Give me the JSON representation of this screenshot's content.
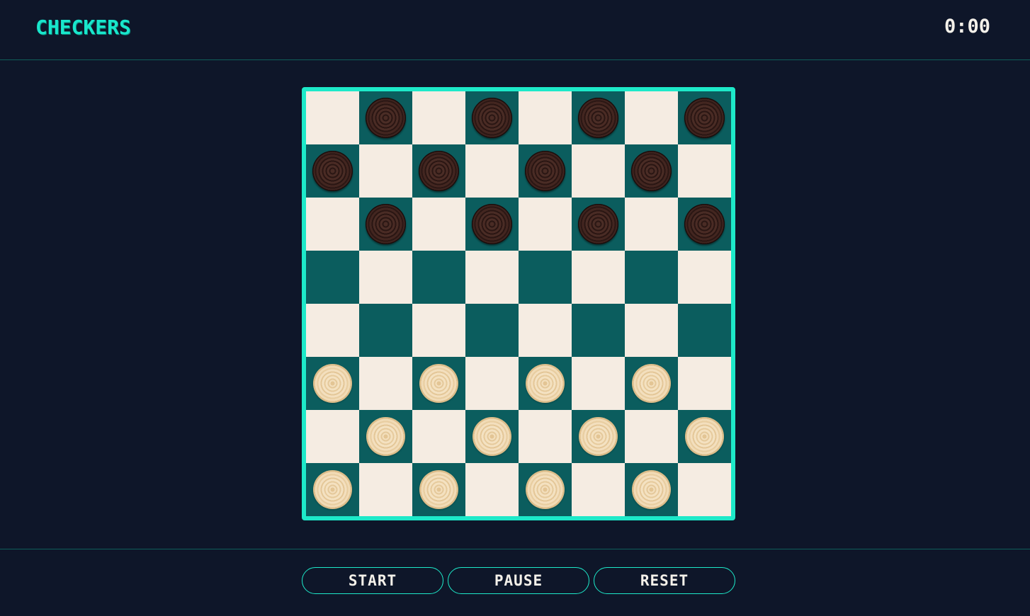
{
  "header": {
    "title": "CHECKERS",
    "timer": "0:00"
  },
  "board": {
    "size": 8,
    "colors": {
      "light_square": "#f5ece2",
      "dark_square": "#0b5d5e",
      "frame": "#1de9c9"
    },
    "rows": [
      [
        ".",
        "b",
        ".",
        "b",
        ".",
        "b",
        ".",
        "b"
      ],
      [
        "b",
        ".",
        "b",
        ".",
        "b",
        ".",
        "b",
        "."
      ],
      [
        ".",
        "b",
        ".",
        "b",
        ".",
        "b",
        ".",
        "b"
      ],
      [
        ".",
        ".",
        ".",
        ".",
        ".",
        ".",
        ".",
        "."
      ],
      [
        ".",
        ".",
        ".",
        ".",
        ".",
        ".",
        ".",
        "."
      ],
      [
        "w",
        ".",
        "w",
        ".",
        "w",
        ".",
        "w",
        "."
      ],
      [
        ".",
        "w",
        ".",
        "w",
        ".",
        "w",
        ".",
        "w"
      ],
      [
        "w",
        ".",
        "w",
        ".",
        "w",
        ".",
        "w",
        "."
      ]
    ]
  },
  "controls": {
    "start_label": "START",
    "pause_label": "PAUSE",
    "reset_label": "RESET"
  },
  "theme": {
    "background": "#0e1629",
    "accent": "#1de9c9",
    "text": "#f4f1ea"
  }
}
